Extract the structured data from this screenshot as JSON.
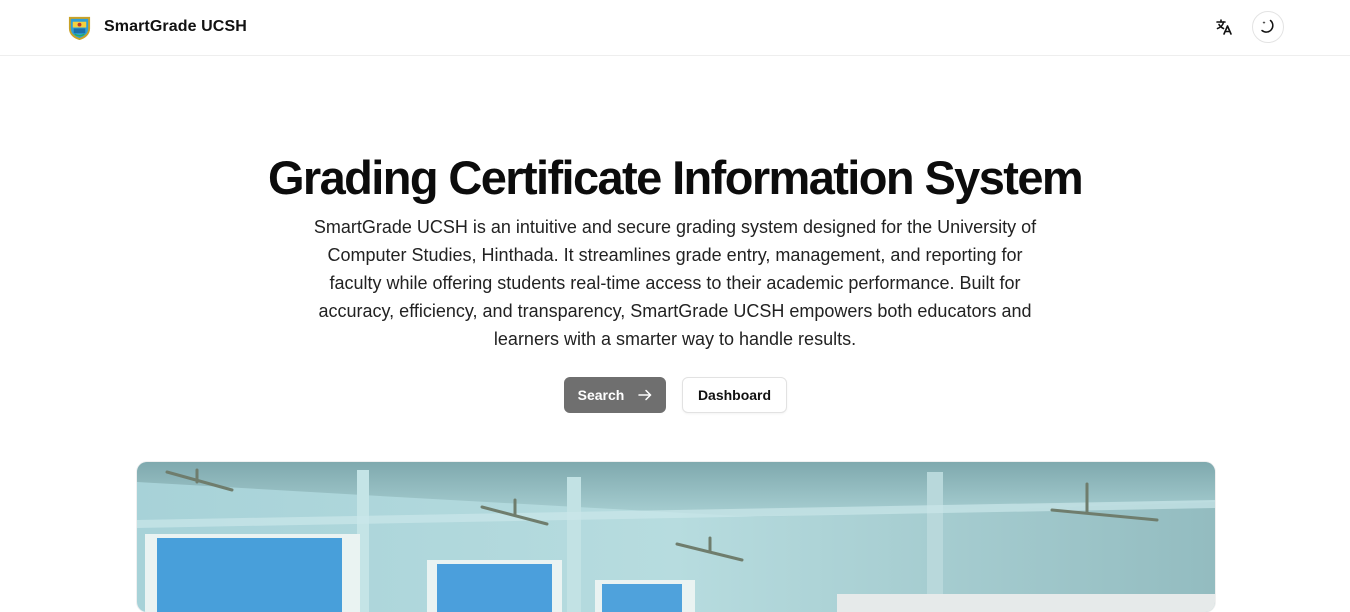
{
  "header": {
    "brand_name": "SmartGrade UCSH",
    "logo_icon": "ucsh-shield-logo",
    "language_icon": "translate-icon",
    "theme_icon": "moon-icon"
  },
  "hero": {
    "title": "Grading Certificate Information System",
    "description": "SmartGrade UCSH is an intuitive and secure grading system designed for the University of Computer Studies, Hinthada. It streamlines grade entry, management, and reporting for faculty while offering students real-time access to their academic performance. Built for accuracy, efficiency, and transparency, SmartGrade UCSH empowers both educators and learners with a smarter way to handle results.",
    "search_label": "Search",
    "search_icon": "arrow-right-icon",
    "dashboard_label": "Dashboard",
    "image": "classroom-photo"
  },
  "colors": {
    "primary_button": "#6f6f6f",
    "text": "#111111",
    "border": "#e3e3e3"
  }
}
